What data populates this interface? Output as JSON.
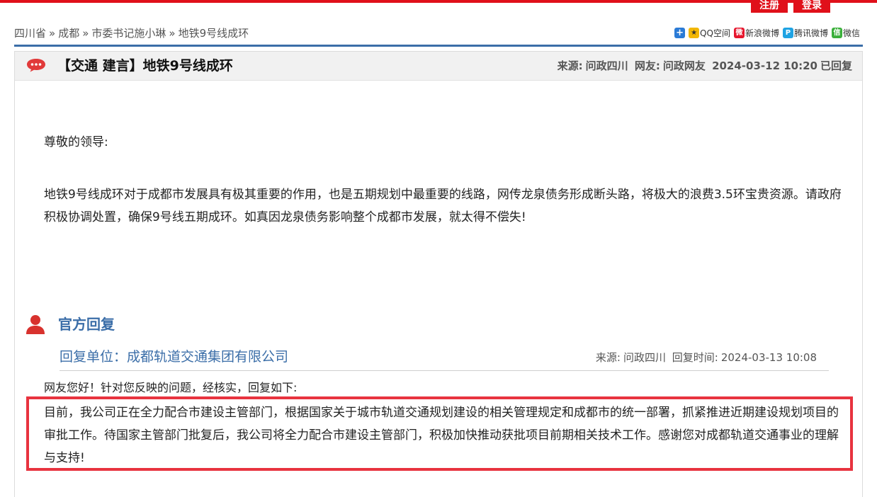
{
  "header": {
    "register_label": "注册",
    "login_label": "登录"
  },
  "breadcrumb": [
    "四川省",
    "成都",
    "市委书记施小琳",
    "地铁9号线成环"
  ],
  "breadcrumb_sep": "»",
  "share": [
    {
      "icon": "plus-icon",
      "glyph": "+",
      "label": ""
    },
    {
      "icon": "qq-zone-icon",
      "glyph": "★",
      "label": "QQ空间"
    },
    {
      "icon": "sina-weibo-icon",
      "glyph": "微",
      "label": "新浪微博"
    },
    {
      "icon": "tencent-weibo-icon",
      "glyph": "P",
      "label": "腾讯微博"
    },
    {
      "icon": "wechat-icon",
      "glyph": "信",
      "label": "微信"
    }
  ],
  "post": {
    "title": "【交通 建言】地铁9号线成环",
    "source_label": "来源:",
    "source": "问政四川",
    "user_label": "网友:",
    "user": "问政网友",
    "date": "2024-03-12 10:20",
    "status": "已回复",
    "greeting": "尊敬的领导:",
    "body": "地铁9号线成环对于成都市发展具有极其重要的作用，也是五期规划中最重要的线路，网传龙泉债务形成断头路，将极大的浪费3.5环宝贵资源。请政府积极协调处置，确保9号线五期成环。如真因龙泉债务影响整个成都市发展，就太得不偿失!"
  },
  "reply": {
    "section_title": "官方回复",
    "unit": "回复单位：成都轨道交通集团有限公司",
    "source_label": "来源:",
    "source": "问政四川",
    "time_label": "回复时间:",
    "time": "2024-03-13 10:08",
    "intro": "网友您好！针对您反映的问题，经核实，回复如下:",
    "body": "目前，我公司正在全力配合市建设主管部门，根据国家关于城市轨道交通规划建设的相关管理规定和成都市的统一部署，抓紧推进近期建设规划项目的审批工作。待国家主管部门批复后，我公司将全力配合市建设主管部门，积极加快推动获批项目前期相关技术工作。感谢您对成都轨道交通事业的理解与支持!"
  },
  "colors": {
    "brand_red": "#e0101a",
    "link_blue": "#3b6ea8",
    "highlight_red": "#e8333f"
  }
}
